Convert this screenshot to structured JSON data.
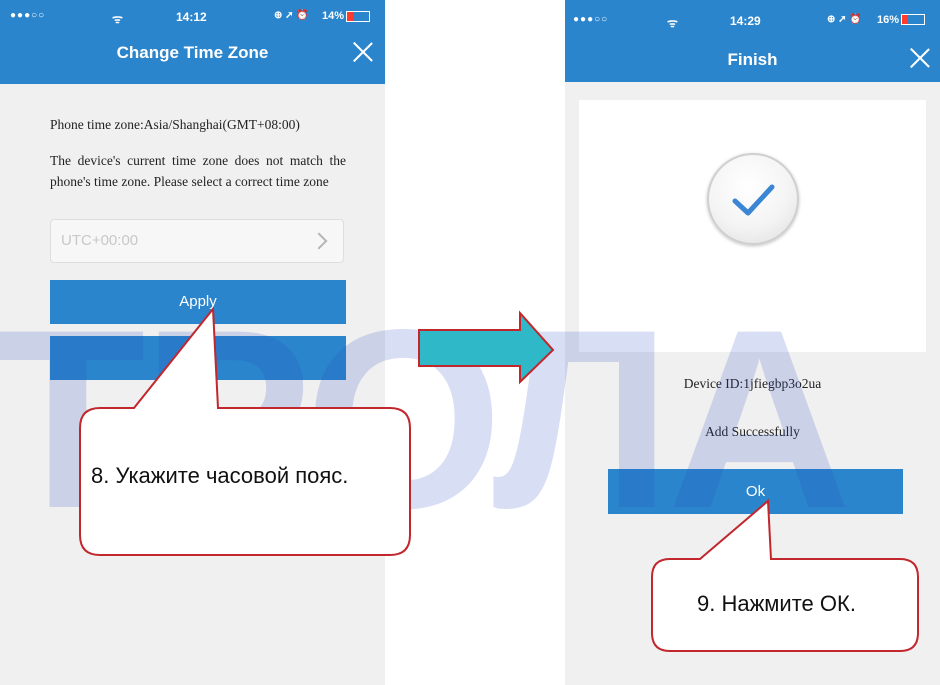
{
  "left_screen": {
    "status": {
      "signal": "●●●○○",
      "wifi": "ᯤ",
      "time": "14:12",
      "icons": "⊕ ➚ ⏰",
      "battery": "14%"
    },
    "title": "Change Time Zone",
    "phone_tz": "Phone time zone:Asia/Shanghai(GMT+08:00)",
    "message": "The device's current time zone does not match the phone's time zone. Please select a correct time zone",
    "select_value": "UTC+00:00",
    "apply_label": "Apply"
  },
  "right_screen": {
    "status": {
      "signal": "●●●○○",
      "wifi": "ᯤ",
      "time": "14:29",
      "icons": "⊕ ➚ ⏰",
      "battery": "16%"
    },
    "title": "Finish",
    "device_id": "Device ID:1jfiegbp3o2ua",
    "success": "Add Successfully",
    "ok_label": "Ok"
  },
  "callouts": {
    "step8": "8. Укажите часовой пояс.",
    "step9": "9. Нажмите ОК."
  },
  "watermark": "ТРОЛА",
  "colors": {
    "nav_blue": "#2a85cc",
    "callout_red": "#c1272d",
    "arrow_teal": "#2fb8c8",
    "check_blue": "#3a86d4"
  }
}
